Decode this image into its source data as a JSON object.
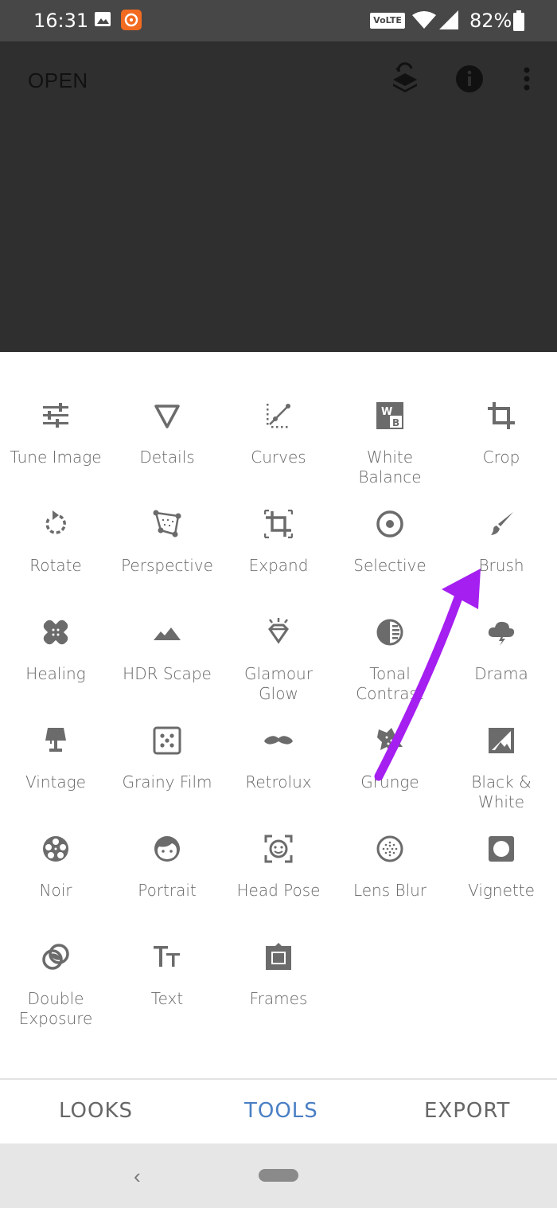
{
  "status_bar": {
    "time": "16:31",
    "volte": "VoLTE",
    "battery": "82%"
  },
  "header": {
    "open_label": "OPEN"
  },
  "tools": [
    {
      "label": "Tune Image",
      "icon": "tune-icon"
    },
    {
      "label": "Details",
      "icon": "details-icon"
    },
    {
      "label": "Curves",
      "icon": "curves-icon"
    },
    {
      "label": "White Balance",
      "icon": "white-balance-icon"
    },
    {
      "label": "Crop",
      "icon": "crop-icon"
    },
    {
      "label": "Rotate",
      "icon": "rotate-icon"
    },
    {
      "label": "Perspective",
      "icon": "perspective-icon"
    },
    {
      "label": "Expand",
      "icon": "expand-icon"
    },
    {
      "label": "Selective",
      "icon": "selective-icon"
    },
    {
      "label": "Brush",
      "icon": "brush-icon"
    },
    {
      "label": "Healing",
      "icon": "healing-icon"
    },
    {
      "label": "HDR Scape",
      "icon": "hdr-scape-icon"
    },
    {
      "label": "Glamour Glow",
      "icon": "glamour-glow-icon"
    },
    {
      "label": "Tonal Contrast",
      "icon": "tonal-contrast-icon"
    },
    {
      "label": "Drama",
      "icon": "drama-icon"
    },
    {
      "label": "Vintage",
      "icon": "vintage-icon"
    },
    {
      "label": "Grainy Film",
      "icon": "grainy-film-icon"
    },
    {
      "label": "Retrolux",
      "icon": "retrolux-icon"
    },
    {
      "label": "Grunge",
      "icon": "grunge-icon"
    },
    {
      "label": "Black & White",
      "icon": "black-white-icon"
    },
    {
      "label": "Noir",
      "icon": "noir-icon"
    },
    {
      "label": "Portrait",
      "icon": "portrait-icon"
    },
    {
      "label": "Head Pose",
      "icon": "head-pose-icon"
    },
    {
      "label": "Lens Blur",
      "icon": "lens-blur-icon"
    },
    {
      "label": "Vignette",
      "icon": "vignette-icon"
    },
    {
      "label": "Double Exposure",
      "icon": "double-exposure-icon"
    },
    {
      "label": "Text",
      "icon": "text-icon"
    },
    {
      "label": "Frames",
      "icon": "frames-icon"
    }
  ],
  "bottom_tabs": {
    "looks": "LOOKS",
    "tools": "TOOLS",
    "export": "EXPORT"
  },
  "colors": {
    "active_tab": "#4a7fc4",
    "inactive_tab": "#666666",
    "annotation_arrow": "#a51ff0",
    "icon_gray": "#6b6b6b"
  }
}
